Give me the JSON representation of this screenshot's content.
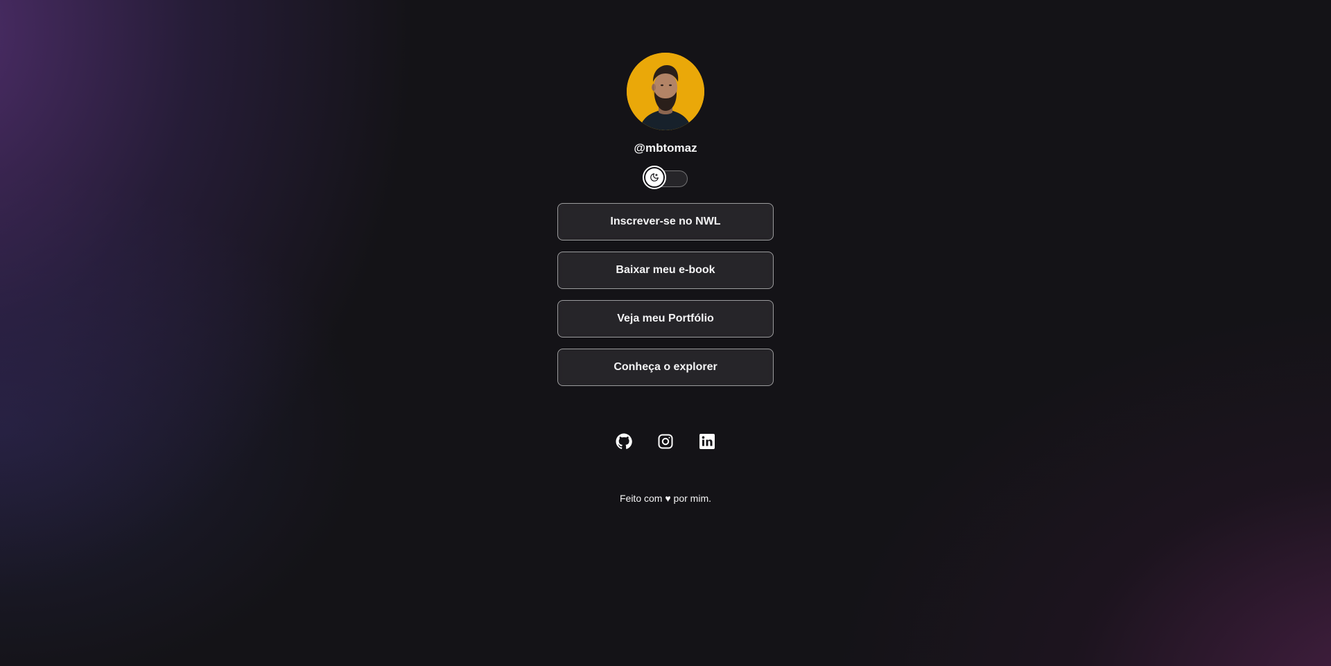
{
  "profile": {
    "username": "@mbtomaz",
    "avatar_alt": "avatar",
    "avatar_bg_color": "#eaa809"
  },
  "theme_switch": {
    "icon": "moon-icon",
    "state": "dark"
  },
  "links": [
    {
      "label": "Inscrever-se no NWL"
    },
    {
      "label": "Baixar meu e-book"
    },
    {
      "label": "Veja meu Portfólio"
    },
    {
      "label": "Conheça o explorer"
    }
  ],
  "social": [
    {
      "name": "github-icon"
    },
    {
      "name": "instagram-icon"
    },
    {
      "name": "linkedin-icon"
    }
  ],
  "footer": {
    "text_before": "Feito com",
    "heart": "♥",
    "text_after": "por mim."
  },
  "colors": {
    "background": "#141317",
    "accent_purple": "#58327a",
    "accent_magenta": "#552350",
    "text": "#f4f4f5"
  }
}
